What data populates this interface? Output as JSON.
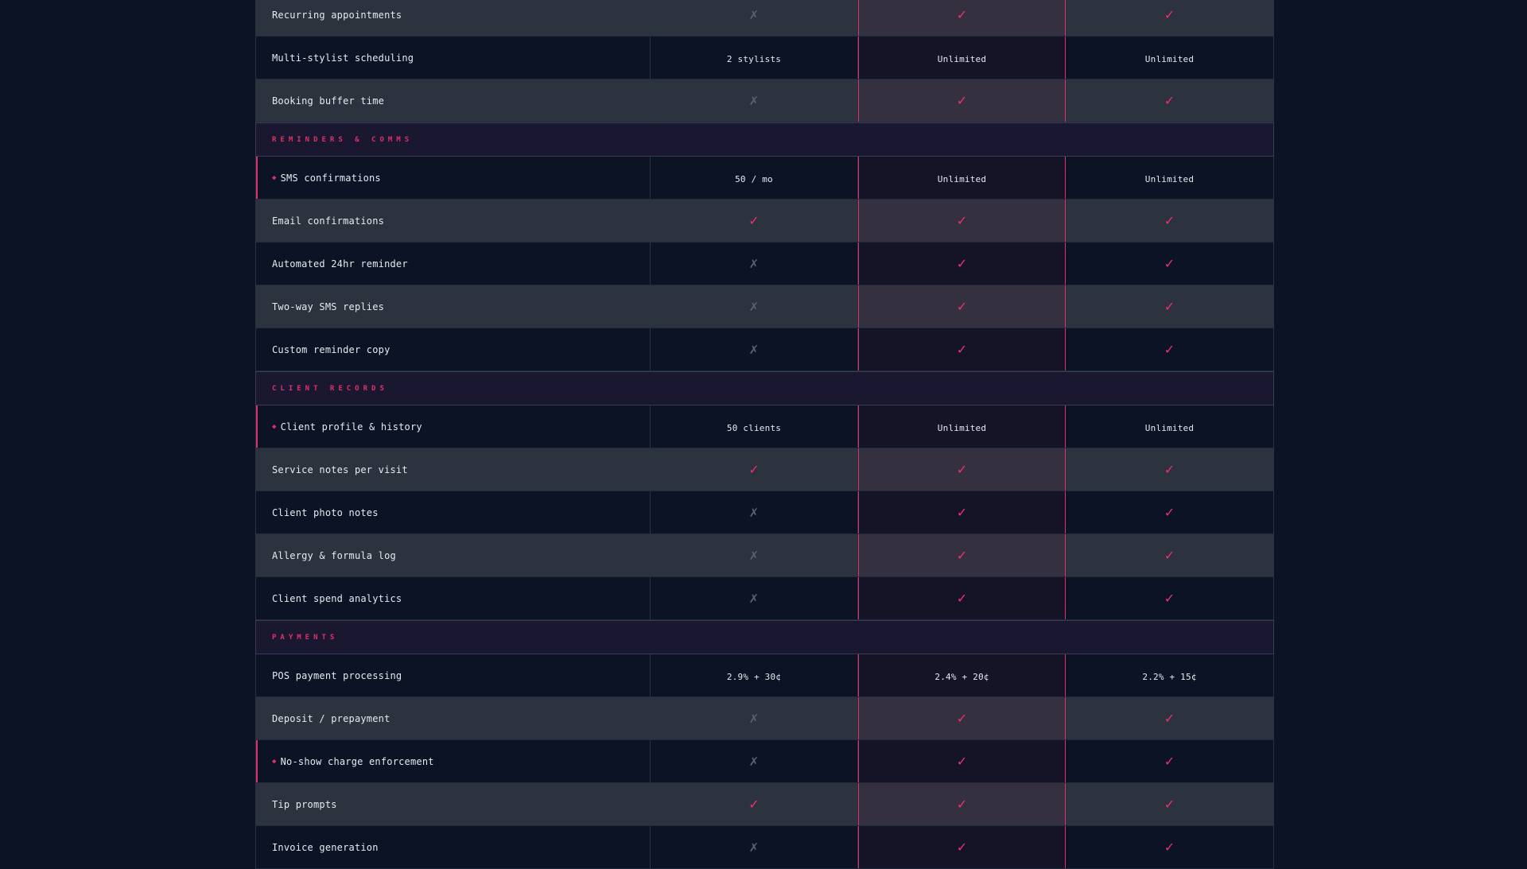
{
  "rows": [
    {
      "type": "feature",
      "label": "Recurring appointments",
      "vals": [
        "✗",
        "✓",
        "✓"
      ]
    },
    {
      "type": "feature",
      "label": "Multi-stylist scheduling",
      "vals": [
        "2 stylists",
        "Unlimited",
        "Unlimited"
      ]
    },
    {
      "type": "feature",
      "label": "Booking buffer time",
      "vals": [
        "✗",
        "✓",
        "✓"
      ]
    },
    {
      "type": "section",
      "label": "REMINDERS & COMMS"
    },
    {
      "type": "feature",
      "label": "SMS confirmations",
      "flag": true,
      "vals": [
        "50 / mo",
        "Unlimited",
        "Unlimited"
      ]
    },
    {
      "type": "feature",
      "label": "Email confirmations",
      "vals": [
        "✓",
        "✓",
        "✓"
      ]
    },
    {
      "type": "feature",
      "label": "Automated 24hr reminder",
      "vals": [
        "✗",
        "✓",
        "✓"
      ]
    },
    {
      "type": "feature",
      "label": "Two-way SMS replies",
      "vals": [
        "✗",
        "✓",
        "✓"
      ]
    },
    {
      "type": "feature",
      "label": "Custom reminder copy",
      "vals": [
        "✗",
        "✓",
        "✓"
      ]
    },
    {
      "type": "section",
      "label": "CLIENT RECORDS"
    },
    {
      "type": "feature",
      "label": "Client profile & history",
      "flag": true,
      "vals": [
        "50 clients",
        "Unlimited",
        "Unlimited"
      ]
    },
    {
      "type": "feature",
      "label": "Service notes per visit",
      "vals": [
        "✓",
        "✓",
        "✓"
      ]
    },
    {
      "type": "feature",
      "label": "Client photo notes",
      "vals": [
        "✗",
        "✓",
        "✓"
      ]
    },
    {
      "type": "feature",
      "label": "Allergy & formula log",
      "vals": [
        "✗",
        "✓",
        "✓"
      ]
    },
    {
      "type": "feature",
      "label": "Client spend analytics",
      "vals": [
        "✗",
        "✓",
        "✓"
      ]
    },
    {
      "type": "section",
      "label": "PAYMENTS"
    },
    {
      "type": "feature",
      "label": "POS payment processing",
      "vals": [
        "2.9% + 30¢",
        "2.4% + 20¢",
        "2.2% + 15¢"
      ]
    },
    {
      "type": "feature",
      "label": "Deposit / prepayment",
      "vals": [
        "✗",
        "✓",
        "✓"
      ]
    },
    {
      "type": "feature",
      "label": "No-show charge enforcement",
      "flag": true,
      "vals": [
        "✗",
        "✓",
        "✓"
      ]
    },
    {
      "type": "feature",
      "label": "Tip prompts",
      "vals": [
        "✓",
        "✓",
        "✓"
      ]
    },
    {
      "type": "feature",
      "label": "Invoice generation",
      "vals": [
        "✗",
        "✓",
        "✓"
      ]
    }
  ],
  "colors": {
    "accent": "#e0306a",
    "background": "#0b1324",
    "row_alt": "#2c323e",
    "section_bg": "#1a1830"
  },
  "icons": {
    "check": "check-icon",
    "cross": "cross-icon",
    "flag_dot": "dot-icon"
  }
}
